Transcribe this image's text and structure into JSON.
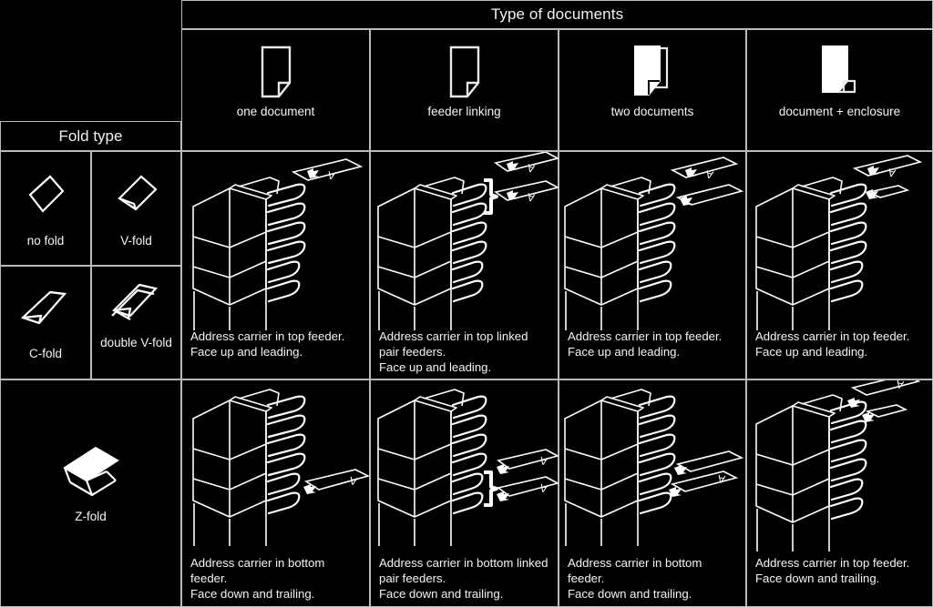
{
  "table": {
    "col_header_title": "Type of documents",
    "row_header_title": "Fold type",
    "document_types": [
      {
        "id": "one-document",
        "label": "one document",
        "icon": "single-page-icon"
      },
      {
        "id": "feeder-linking",
        "label": "feeder linking",
        "icon": "single-page-icon"
      },
      {
        "id": "two-documents",
        "label": "two documents",
        "icon": "two-pages-icon"
      },
      {
        "id": "document-enclosure",
        "label": "document + enclosure",
        "icon": "page-plus-enclosure-icon"
      }
    ],
    "fold_types": [
      {
        "id": "no-fold",
        "label": "no fold",
        "icon": "no-fold-icon"
      },
      {
        "id": "v-fold",
        "label": "V-fold",
        "icon": "v-fold-icon"
      },
      {
        "id": "c-fold",
        "label": "C-fold",
        "icon": "c-fold-icon"
      },
      {
        "id": "double-v-fold",
        "label": "double\nV-fold",
        "icon": "double-v-fold-icon"
      },
      {
        "id": "z-fold",
        "label": "Z-fold",
        "icon": "z-fold-icon"
      }
    ],
    "rows": [
      {
        "id": "row-standard-folds",
        "cells": [
          {
            "id": "r1c1",
            "caption": "Address carrier in top feeder.\nFace up and leading.",
            "sheets": 1,
            "linked": false,
            "position": "top"
          },
          {
            "id": "r1c2",
            "caption": "Address carrier in top linked\npair feeders.\nFace up and leading.",
            "sheets": 2,
            "linked": true,
            "position": "top"
          },
          {
            "id": "r1c3",
            "caption": "Address carrier in top feeder.\nFace up and leading.",
            "sheets": 2,
            "linked": false,
            "position": "top"
          },
          {
            "id": "r1c4",
            "caption": "Address carrier in top feeder.\nFace up and leading.",
            "sheets": 2,
            "linked": false,
            "position": "top"
          }
        ]
      },
      {
        "id": "row-z-fold",
        "cells": [
          {
            "id": "r2c1",
            "caption": "Address carrier in bottom feeder.\nFace down and trailing.",
            "sheets": 1,
            "linked": false,
            "position": "bottom"
          },
          {
            "id": "r2c2",
            "caption": "Address carrier in bottom linked\npair feeders.\nFace down and trailing.",
            "sheets": 2,
            "linked": true,
            "position": "bottom"
          },
          {
            "id": "r2c3",
            "caption": "Address carrier in bottom feeder.\nFace down and trailing.",
            "sheets": 2,
            "linked": false,
            "position": "bottom"
          },
          {
            "id": "r2c4",
            "caption": "Address carrier in top feeder.\nFace down and trailing.",
            "sheets": 2,
            "linked": false,
            "position": "top"
          }
        ]
      }
    ]
  },
  "colors": {
    "background": "#000000",
    "line": "#b9b9b9",
    "text": "#f4f4f4",
    "artwork": "#ffffff"
  }
}
